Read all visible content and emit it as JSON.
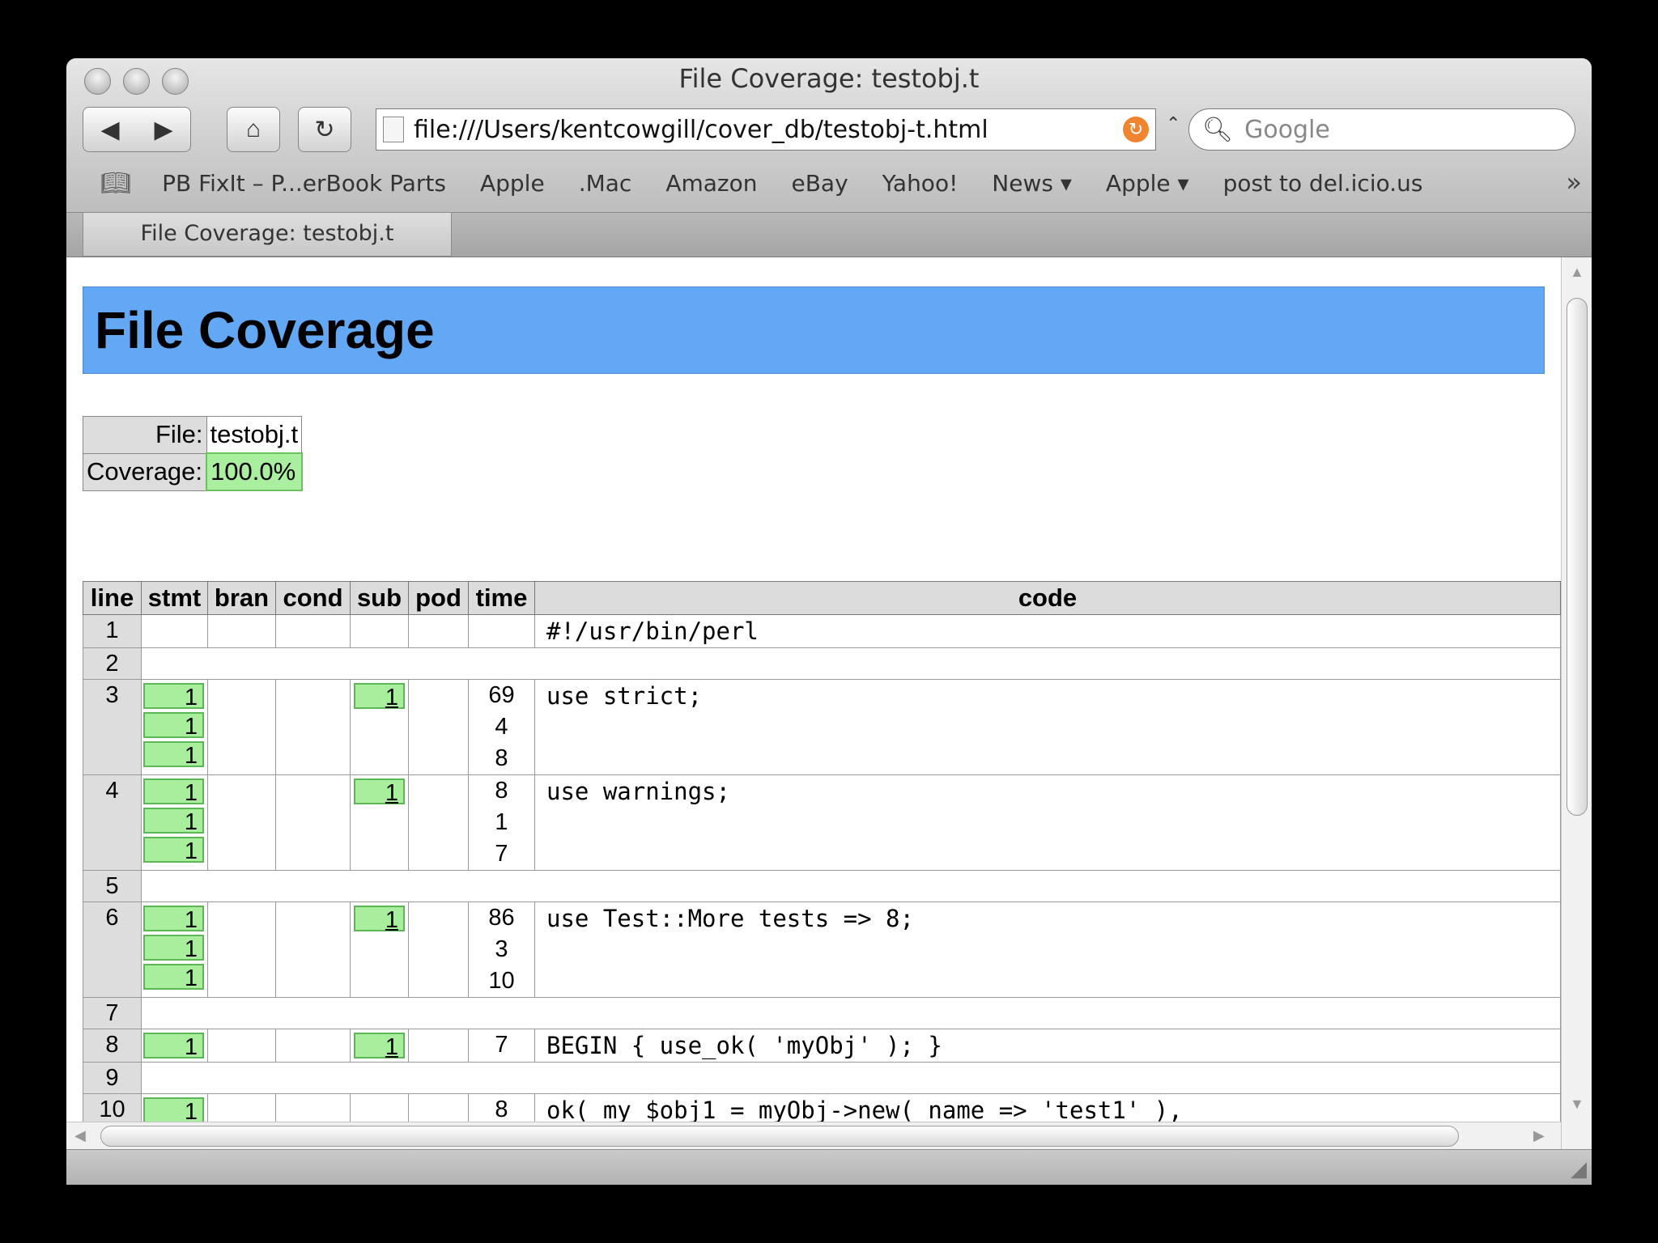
{
  "window": {
    "title": "File Coverage: testobj.t"
  },
  "toolbar": {
    "url": "file:///Users/kentcowgill/cover_db/testobj-t.html",
    "search_placeholder": "Google"
  },
  "bookmarks": [
    "PB FixIt – P...erBook Parts",
    "Apple",
    ".Mac",
    "Amazon",
    "eBay",
    "Yahoo!",
    "News ▾",
    "Apple ▾",
    "post to del.icio.us"
  ],
  "tab": {
    "label": "File Coverage: testobj.t"
  },
  "page": {
    "heading": "File Coverage",
    "file_label": "File:",
    "file_value": "testobj.t",
    "coverage_label": "Coverage:",
    "coverage_value": "100.0%"
  },
  "table": {
    "headers": [
      "line",
      "stmt",
      "bran",
      "cond",
      "sub",
      "pod",
      "time",
      "code"
    ],
    "rows": [
      {
        "line": "1",
        "stmt": [],
        "sub": "",
        "time": [],
        "code": "#!/usr/bin/perl"
      },
      {
        "line": "2",
        "blank": true
      },
      {
        "line": "3",
        "stmt": [
          "1",
          "1",
          "1"
        ],
        "sub": "1",
        "time": [
          "69",
          "4",
          "8"
        ],
        "code": "use strict;"
      },
      {
        "line": "4",
        "stmt": [
          "1",
          "1",
          "1"
        ],
        "sub": "1",
        "time": [
          "8",
          "1",
          "7"
        ],
        "code": "use warnings;"
      },
      {
        "line": "5",
        "blank": true
      },
      {
        "line": "6",
        "stmt": [
          "1",
          "1",
          "1"
        ],
        "sub": "1",
        "time": [
          "86",
          "3",
          "10"
        ],
        "code": "use Test::More tests => 8;"
      },
      {
        "line": "7",
        "blank": true
      },
      {
        "line": "8",
        "stmt": [
          "1"
        ],
        "sub": "1",
        "time": [
          "7"
        ],
        "code": "BEGIN { use_ok( 'myObj' ); }"
      },
      {
        "line": "9",
        "blank": true
      },
      {
        "line": "10",
        "stmt": [
          "1"
        ],
        "sub": "",
        "time": [
          "8"
        ],
        "code": "ok( my $obj1 = myObj->new( name => 'test1' ),"
      }
    ]
  },
  "colors": {
    "banner": "#63a8f4",
    "covered": "#a9ee9c",
    "header": "#dcdcdc"
  }
}
